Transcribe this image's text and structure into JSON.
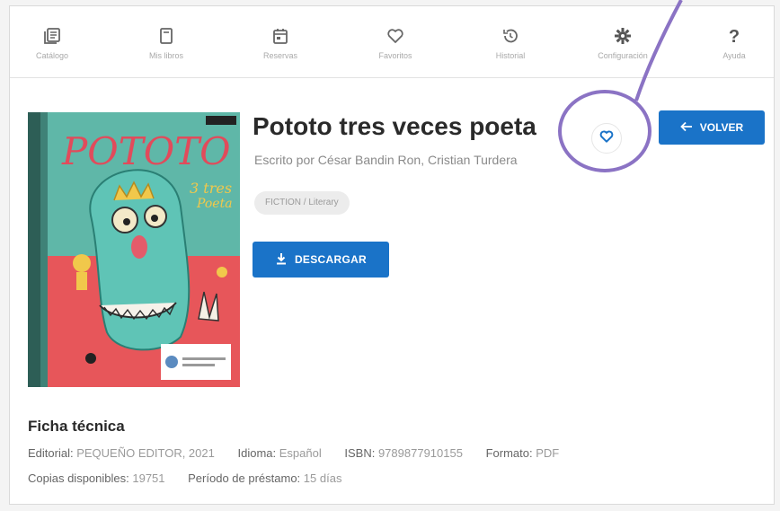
{
  "nav": [
    {
      "label": "Catálogo",
      "icon": "catalog-icon"
    },
    {
      "label": "Mis libros",
      "icon": "book-icon"
    },
    {
      "label": "Reservas",
      "icon": "calendar-icon"
    },
    {
      "label": "Favoritos",
      "icon": "heart-icon"
    },
    {
      "label": "Historial",
      "icon": "history-icon"
    },
    {
      "label": "Configuración",
      "icon": "gear-icon"
    },
    {
      "label": "Ayuda",
      "icon": "question-icon",
      "glyph": "?"
    }
  ],
  "book": {
    "title": "Pototo tres veces poeta",
    "authors": "Escrito por César Bandin Ron, Cristian Turdera",
    "genre": "FICTION / Literary",
    "cover": {
      "title": "POTOTO",
      "subtitle_line1": "3 tres",
      "subtitle_line2": "Poeta"
    }
  },
  "actions": {
    "download_label": "DESCARGAR",
    "back_label": "VOLVER"
  },
  "ficha": {
    "title": "Ficha técnica",
    "editorial_key": "Editorial:",
    "editorial_val": "PEQUEÑO EDITOR, 2021",
    "idioma_key": "Idioma:",
    "idioma_val": "Español",
    "isbn_key": "ISBN:",
    "isbn_val": "9789877910155",
    "formato_key": "Formato:",
    "formato_val": "PDF",
    "copias_key": "Copias disponibles:",
    "copias_val": "19751",
    "periodo_key": "Período de préstamo:",
    "periodo_val": "15 días"
  },
  "colors": {
    "accent": "#1a73c8",
    "annotation": "#8b73c4"
  }
}
